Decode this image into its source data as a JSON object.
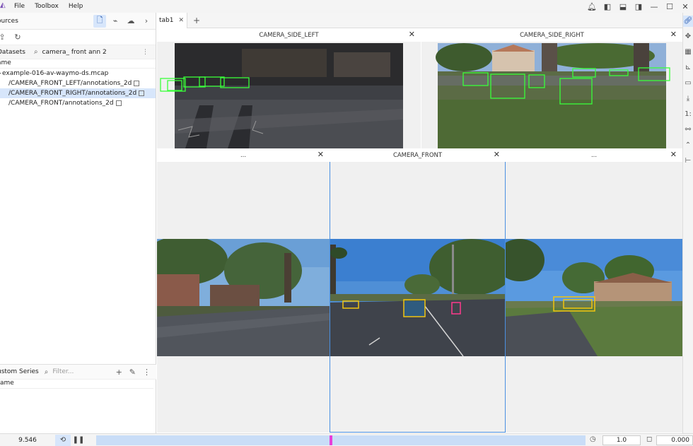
{
  "menu": {
    "items": [
      "File",
      "Toolbox",
      "Help"
    ]
  },
  "sidebar": {
    "sources_title": "ources",
    "datasets_label": "Datasets",
    "search_query": "camera_ front ann 2",
    "column_name": "ame",
    "tree": {
      "root": "example-016-av-waymo-ds.mcap",
      "children": [
        "/CAMERA_FRONT_LEFT/annotations_2d",
        "/CAMERA_FRONT_RIGHT/annotations_2d",
        "/CAMERA_FRONT/annotations_2d"
      ]
    },
    "custom_series_label": "ustom Series",
    "filter_placeholder": "Filter...",
    "custom_column_name": "ame"
  },
  "tabs": {
    "items": [
      {
        "label": "tab1"
      }
    ]
  },
  "panels": {
    "side_left": "CAMERA_SIDE_LEFT",
    "side_right": "CAMERA_SIDE_RIGHT",
    "front_left": "...",
    "front": "CAMERA_FRONT",
    "front_right": "..."
  },
  "playback": {
    "current_time": "9.546",
    "speed": "1.0",
    "offset": "0.000",
    "progress": 0.48
  },
  "colors": {
    "accent": "#4a90e2",
    "selection": "#d7e6fb",
    "box_green": "#39ff39",
    "box_yellow": "#f2c40f",
    "box_pink": "#ff3b8d",
    "timeline": "#c9ddf7",
    "playhead": "#e83fd9"
  }
}
